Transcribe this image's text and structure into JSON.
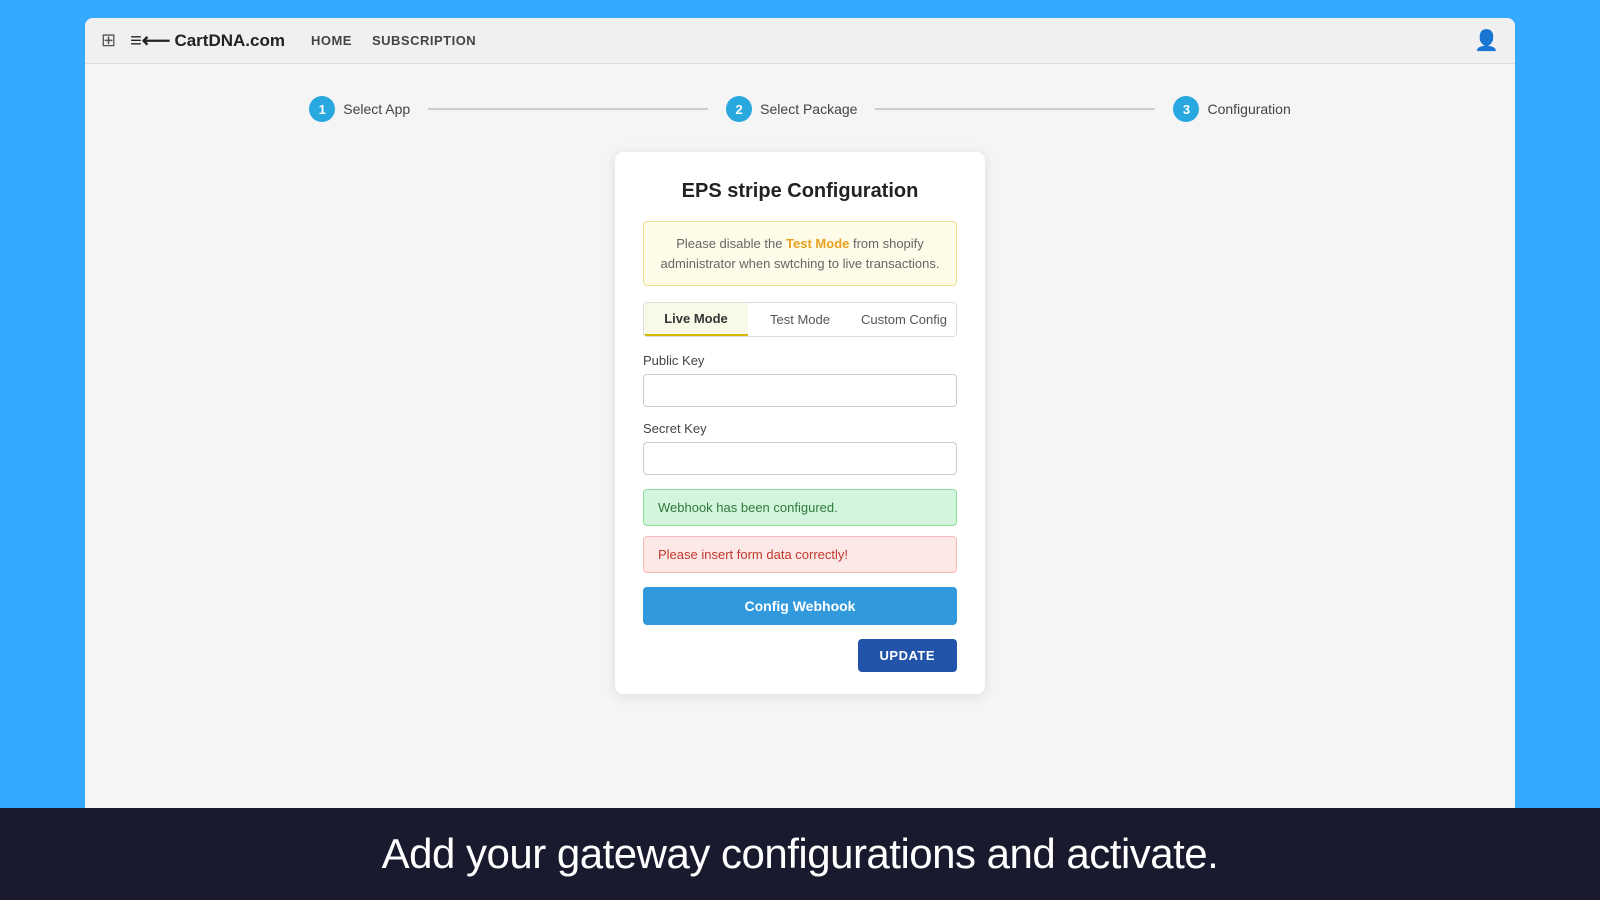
{
  "browser": {
    "nav": {
      "home": "HOME",
      "subscription": "SUBSCRIPTION"
    },
    "logo": "≡⟵CartDNA.com"
  },
  "stepper": {
    "steps": [
      {
        "number": "1",
        "label": "Select App"
      },
      {
        "number": "2",
        "label": "Select Package"
      },
      {
        "number": "3",
        "label": "Configuration"
      }
    ]
  },
  "card": {
    "title": "EPS stripe Configuration",
    "warning": {
      "prefix": "Please disable the ",
      "highlight": "Test Mode",
      "suffix": " from shopify administrator when swtching to live transactions."
    },
    "tabs": [
      {
        "label": "Live Mode",
        "active": true
      },
      {
        "label": "Test Mode",
        "active": false
      },
      {
        "label": "Custom Config",
        "active": false
      }
    ],
    "fields": {
      "public_key_label": "Public Key",
      "public_key_placeholder": "",
      "secret_key_label": "Secret Key",
      "secret_key_placeholder": ""
    },
    "success_message": "Webhook has been configured.",
    "error_message": "Please insert form data correctly!",
    "config_webhook_button": "Config Webhook",
    "update_button": "UPDATE"
  },
  "caption": "Add your gateway configurations and activate."
}
